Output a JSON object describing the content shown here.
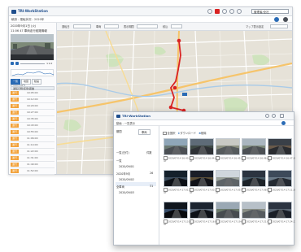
{
  "back_window": {
    "app_name": "TRI-WorkStation",
    "breadcrumb": "軌跡 - 運転状況 - 2020年",
    "account_select": "管理者/全社",
    "date_line": "2020年9月1日 (火)",
    "vehicle_line": "11:06 47 車両走行経路情報",
    "playback_speed": "×1.0",
    "tabs": [
      "一覧",
      "地図",
      "動画",
      "運転詳細"
    ],
    "trip_table_header": "運転日時/区間/距離",
    "trips": [
      {
        "tag": "運行",
        "time": "10:05:00"
      },
      {
        "tag": "運行",
        "time": "10:12:00"
      },
      {
        "tag": "運行",
        "time": "10:20:00"
      },
      {
        "tag": "運行",
        "time": "10:27:00"
      },
      {
        "tag": "運行",
        "time": "10:35:00"
      },
      {
        "tag": "運行",
        "time": "10:43:00"
      },
      {
        "tag": "運行",
        "time": "10:55:00"
      },
      {
        "tag": "運行",
        "time": "11:06:00"
      },
      {
        "tag": "運行",
        "time": "11:14:00"
      },
      {
        "tag": "運行",
        "time": "11:22:00"
      },
      {
        "tag": "運行",
        "time": "11:31:00"
      },
      {
        "tag": "運行",
        "time": "11:40:00"
      },
      {
        "tag": "運行",
        "time": "11:52:00"
      }
    ],
    "map_toolbar": {
      "label1": "運転日",
      "label2": "車両",
      "label3": "表示期間",
      "label4": "絞込",
      "right_label": "マップ表示設定"
    }
  },
  "front_window": {
    "app_name": "TRI-WorkStation",
    "breadcrumb": "動画 - 一覧表示",
    "sidebar": {
      "filter_label": "期間",
      "filter_value": "車両",
      "list_header": "一覧(日付)",
      "list_header_right": "件数",
      "items": [
        {
          "label": "一覧",
          "count": ""
        },
        {
          "label": "2020/09/01",
          "count": ""
        },
        {
          "label": "2020年9月",
          "count": "26"
        },
        {
          "label": "2020/09/02",
          "count": ""
        },
        {
          "label": "全車両",
          "count": "31"
        },
        {
          "label": "2020/09/03",
          "count": ""
        }
      ]
    },
    "toolbar": {
      "select_all": "全選択",
      "download": "ダウンロード",
      "delete": "削除"
    },
    "thumbs": [
      {
        "cap1": "2020/07/14 16:43:31",
        "cap2": "47"
      },
      {
        "cap1": "2020/07/14 16:44:00",
        "cap2": "47"
      },
      {
        "cap1": "2020/07/14 16:45:12",
        "cap2": "47"
      },
      {
        "cap1": "2020/07/14 16:46:02",
        "cap2": "47"
      },
      {
        "cap1": "2020/07/14 16:47:30",
        "cap2": "47"
      },
      {
        "cap1": "2020/07/14 17:01:22",
        "cap2": "47"
      },
      {
        "cap1": "2020/07/14 17:03:10",
        "cap2": "47"
      },
      {
        "cap1": "2020/07/14 17:05:44",
        "cap2": "47"
      },
      {
        "cap1": "2020/07/14 17:08:02",
        "cap2": "47"
      },
      {
        "cap1": "2020/07/14 17:11:30",
        "cap2": "47"
      },
      {
        "cap1": "2020/07/14 17:13:58",
        "cap2": "47"
      },
      {
        "cap1": "2020/07/14 17:16:40",
        "cap2": "47"
      },
      {
        "cap1": "2020/07/14 17:19:05",
        "cap2": "47"
      },
      {
        "cap1": "2020/07/14 17:21:47",
        "cap2": "47"
      },
      {
        "cap1": "2020/07/14 17:24:11",
        "cap2": "47"
      }
    ]
  },
  "colors": {
    "brand": "#1f4e8c",
    "accent": "#2a6bb5",
    "trip_tag": "#f2a23a",
    "route": "#d92323"
  }
}
